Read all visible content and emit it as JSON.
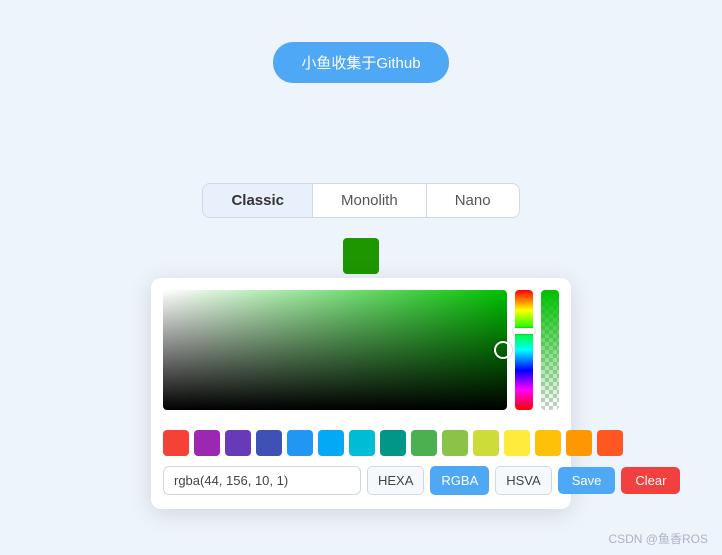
{
  "topButton": {
    "label": "小鱼收集于Github"
  },
  "tabs": {
    "items": [
      {
        "id": "classic",
        "label": "Classic",
        "active": true
      },
      {
        "id": "monolith",
        "label": "Monolith",
        "active": false
      },
      {
        "id": "nano",
        "label": "Nano",
        "active": false
      }
    ]
  },
  "colorPreview": {
    "color": "#1e9600"
  },
  "currentValue": "rgba(44, 156, 10, 1)",
  "formatButtons": [
    "HEXA",
    "RGBA",
    "HSVA"
  ],
  "activeFormat": "RGBA",
  "saveLabel": "Save",
  "clearLabel": "Clear",
  "swatches": [
    "#f44336",
    "#9c27b0",
    "#673ab7",
    "#3f51b5",
    "#2196f3",
    "#03a9f4",
    "#00bcd4",
    "#009688",
    "#4caf50",
    "#8bc34a",
    "#cddc39",
    "#ffeb3b",
    "#ffc107",
    "#ff9800",
    "#ff5722"
  ],
  "watermark": "CSDN @鱼香ROS"
}
